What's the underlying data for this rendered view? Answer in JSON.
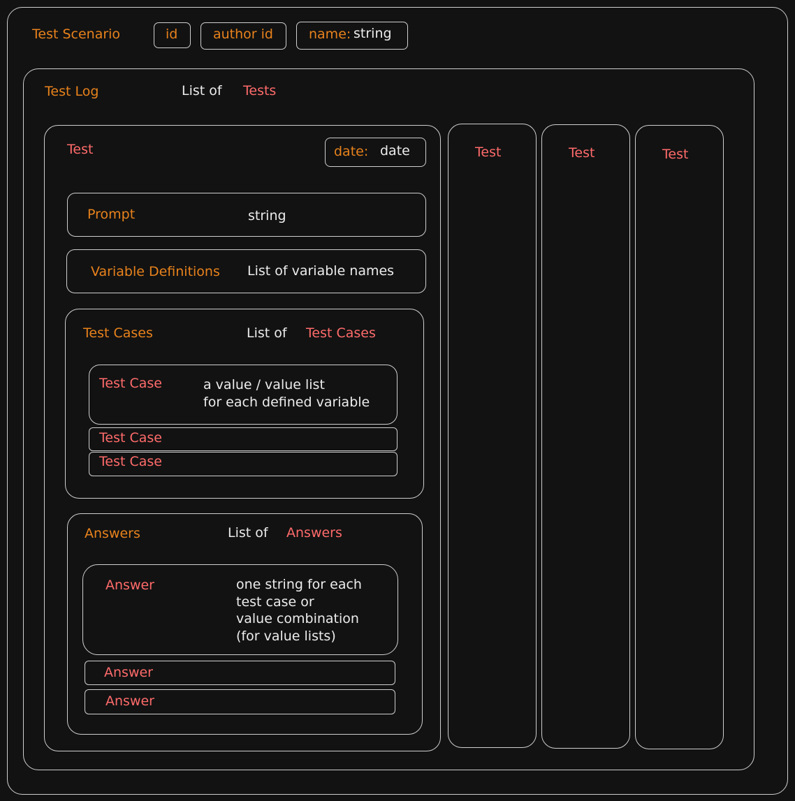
{
  "scenario": {
    "title": "Test Scenario",
    "field_id": "id",
    "field_author": "author id",
    "field_name_key": "name:",
    "field_name_type": "string"
  },
  "test_log": {
    "title": "Test Log",
    "list_prefix": "List of",
    "list_item": "Tests",
    "extra_tests": [
      "Test",
      "Test",
      "Test"
    ]
  },
  "test": {
    "title": "Test",
    "date_key": "date:",
    "date_type": "date",
    "prompt_label": "Prompt",
    "prompt_type": "string",
    "vardef_label": "Variable Definitions",
    "vardef_desc": "List of variable names",
    "cases_label": "Test Cases",
    "cases_prefix": "List of",
    "cases_item": "Test Cases",
    "case_label": "Test Case",
    "case_desc": "a value / value list\nfor each defined variable",
    "case_more": [
      "Test Case",
      "Test Case"
    ],
    "answers_label": "Answers",
    "answers_prefix": "List of",
    "answers_item": "Answers",
    "answer_label": "Answer",
    "answer_desc": "one string for each\ntest case or\nvalue combination\n(for value lists)",
    "answer_more": [
      "Answer",
      "Answer"
    ]
  }
}
